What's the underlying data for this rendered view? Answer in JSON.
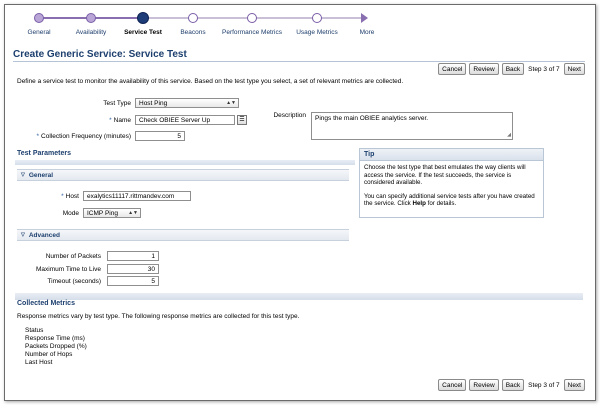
{
  "train": {
    "steps": [
      {
        "label": "General"
      },
      {
        "label": "Availability"
      },
      {
        "label": "Service Test"
      },
      {
        "label": "Beacons"
      },
      {
        "label": "Performance Metrics"
      },
      {
        "label": "Usage Metrics"
      },
      {
        "label": "More"
      }
    ],
    "current_index": 2
  },
  "header": {
    "title": "Create Generic Service: Service Test",
    "cancel": "Cancel",
    "review": "Review",
    "back": "Back",
    "step_text": "Step 3 of 7",
    "next": "Next"
  },
  "intro": "Define a service test to monitor the availability of this service. Based on the test type you select, a set of relevant metrics are collected.",
  "form": {
    "test_type_label": "Test Type",
    "test_type_value": "Host Ping",
    "name_label": "Name",
    "name_value": "Check OBIEE Server Up",
    "freq_label": "Collection Frequency (minutes)",
    "freq_value": "5",
    "description_label": "Description",
    "description_value": "Pings the main OBIEE analytics server.",
    "required_marker": "*",
    "lookup_glyph": "☰"
  },
  "test_params": {
    "title": "Test Parameters",
    "general_title": "General",
    "host_label": "Host",
    "host_value": "exalytics11117.rittmandev.com",
    "mode_label": "Mode",
    "mode_value": "ICMP Ping",
    "advanced_title": "Advanced",
    "packets_label": "Number of Packets",
    "packets_value": "1",
    "ttl_label": "Maximum Time to Live",
    "ttl_value": "30",
    "timeout_label": "Timeout (seconds)",
    "timeout_value": "5"
  },
  "tip": {
    "title": "Tip",
    "p1": "Choose the test type that best emulates the way clients will access the service. If the test succeeds, the service is considered available.",
    "p2_prefix": "You can specify additional service tests after you have created the service. Click ",
    "p2_bold": "Help",
    "p2_suffix": " for details."
  },
  "collected": {
    "title": "Collected Metrics",
    "description": "Response metrics vary by test type. The following response metrics are collected for this test type.",
    "metrics": [
      "Status",
      "Response Time (ms)",
      "Packets Dropped (%)",
      "Number of Hops",
      "Last Host"
    ]
  },
  "glyphs": {
    "expanded": "▽",
    "dropdown": "▲▼",
    "resize": "◢"
  },
  "colors": {
    "train_accent": "#8a6fb0",
    "current_stop": "#1e3c78",
    "header_text": "#1c3f6e"
  }
}
